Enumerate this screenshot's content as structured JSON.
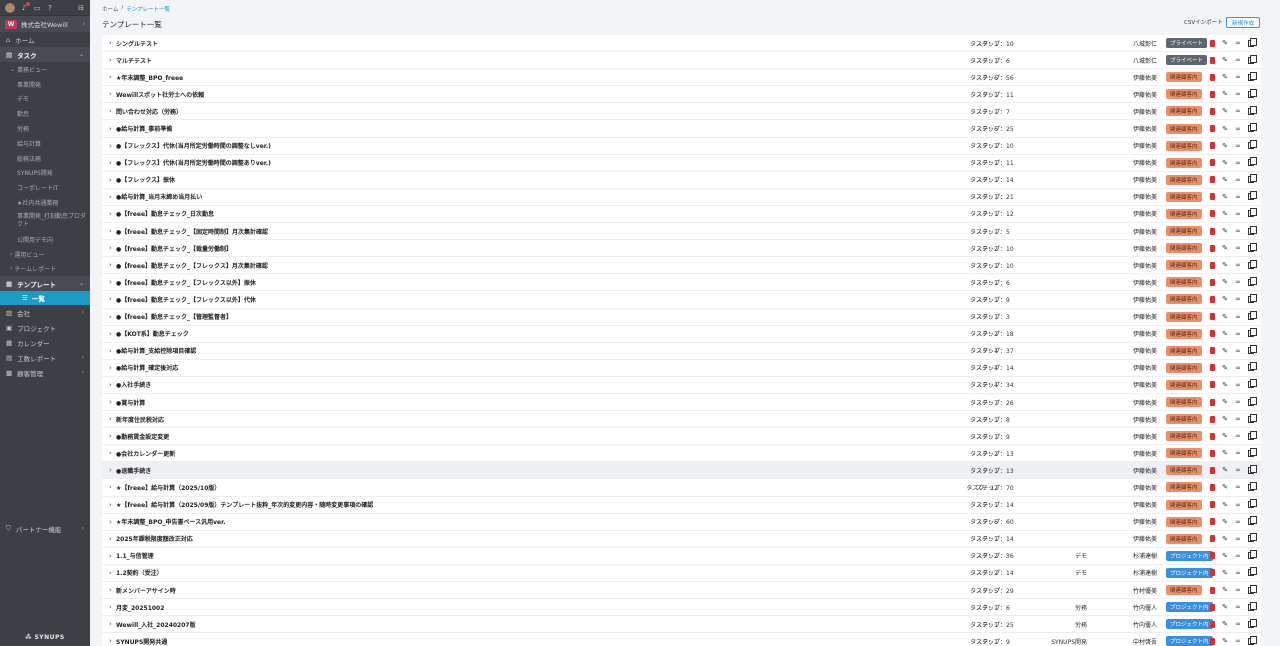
{
  "sidebar": {
    "company": "株式会社Wewill",
    "logo_text": "W",
    "home": "ホーム",
    "task": "タスク",
    "business_view": "業務ビュー",
    "business_view_items": [
      "事業開発",
      "デモ",
      "勤怠",
      "労務",
      "給与計算",
      "総務法務",
      "SYNUPS開発",
      "コーポレートIT",
      "★社内共通業務",
      "事業開発_打刻勤怠プロダクト",
      "公開用デモ向"
    ],
    "operation_view": "運用ビュー",
    "team_report": "チームレポート",
    "template": "テンプレート",
    "list_item": "一覧",
    "company_menu": "会社",
    "project": "プロジェクト",
    "calendar": "カレンダー",
    "work_report": "工数レポート",
    "client_mgmt": "顧客管理",
    "partner": "パートナー機能",
    "brand": "SYNUPS"
  },
  "breadcrumb": {
    "home": "ホーム",
    "sep": "/",
    "current": "テンプレート一覧"
  },
  "page": {
    "title": "テンプレート一覧",
    "csv_import": "CSVインポート",
    "new_button": "新規作成"
  },
  "colors": {
    "accent": "#1d9bc7",
    "private": "#5e6770",
    "related": "#e9906a",
    "project": "#3a8fe0",
    "delete": "#d9302d"
  },
  "rows": [
    {
      "name": "シングルテスト",
      "tasks": "タスク：1",
      "steps": "ステップ：10",
      "client": "",
      "person": "八城彰仁",
      "tag": "プライベート",
      "tag_type": "private"
    },
    {
      "name": "マルチテスト",
      "tasks": "タスク：1",
      "steps": "ステップ：6",
      "client": "",
      "person": "八城彰仁",
      "tag": "プライベート",
      "tag_type": "private"
    },
    {
      "name": "★年末調整_BPO_freee",
      "tasks": "タスク：6",
      "steps": "ステップ：56",
      "client": "",
      "person": "伊藤佑美",
      "tag": "関連顧客内",
      "tag_type": "related"
    },
    {
      "name": "Wewillスポット社労士への依頼",
      "tasks": "タスク：1",
      "steps": "ステップ：11",
      "client": "",
      "person": "伊藤佑美",
      "tag": "関連顧客内",
      "tag_type": "related"
    },
    {
      "name": "問い合わせ対応（労務）",
      "tasks": "タスク：1",
      "steps": "ステップ：7",
      "client": "",
      "person": "伊藤佑美",
      "tag": "関連顧客内",
      "tag_type": "related"
    },
    {
      "name": "●給与計算_事前準備",
      "tasks": "タスク：6",
      "steps": "ステップ：25",
      "client": "",
      "person": "伊藤佑美",
      "tag": "関連顧客内",
      "tag_type": "related"
    },
    {
      "name": "●【フレックス】代休(当月所定労働時間の調整なしver.)",
      "tasks": "タスク：1",
      "steps": "ステップ：10",
      "client": "",
      "person": "伊藤佑美",
      "tag": "関連顧客内",
      "tag_type": "related"
    },
    {
      "name": "●【フレックス】代休(当月所定労働時間の調整ありver.)",
      "tasks": "タスク：1",
      "steps": "ステップ：11",
      "client": "",
      "person": "伊藤佑美",
      "tag": "関連顧客内",
      "tag_type": "related"
    },
    {
      "name": "●【フレックス】振休",
      "tasks": "タスク：1",
      "steps": "ステップ：14",
      "client": "",
      "person": "伊藤佑美",
      "tag": "関連顧客内",
      "tag_type": "related"
    },
    {
      "name": "●給与計算_当月末締め当月払い",
      "tasks": "タスク：1",
      "steps": "ステップ：21",
      "client": "",
      "person": "伊藤佑美",
      "tag": "関連顧客内",
      "tag_type": "related"
    },
    {
      "name": "●【freee】勤怠チェック_日次勤怠",
      "tasks": "タスク：1",
      "steps": "ステップ：12",
      "client": "",
      "person": "伊藤佑美",
      "tag": "関連顧客内",
      "tag_type": "related"
    },
    {
      "name": "●【freee】勤怠チェック_【固定時間制】月次集計確認",
      "tasks": "タスク：1",
      "steps": "ステップ：5",
      "client": "",
      "person": "伊藤佑美",
      "tag": "関連顧客内",
      "tag_type": "related"
    },
    {
      "name": "●【freee】勤怠チェック_【裁量労働制】",
      "tasks": "タスク：2",
      "steps": "ステップ：10",
      "client": "",
      "person": "伊藤佑美",
      "tag": "関連顧客内",
      "tag_type": "related"
    },
    {
      "name": "●【freee】勤怠チェック_【フレックス】月次集計確認",
      "tasks": "タスク：1",
      "steps": "ステップ：10",
      "client": "",
      "person": "伊藤佑美",
      "tag": "関連顧客内",
      "tag_type": "related"
    },
    {
      "name": "●【freee】勤怠チェック_【フレックス以外】振休",
      "tasks": "タスク：1",
      "steps": "ステップ：6",
      "client": "",
      "person": "伊藤佑美",
      "tag": "関連顧客内",
      "tag_type": "related"
    },
    {
      "name": "●【freee】勤怠チェック_【フレックス以外】代休",
      "tasks": "タスク：1",
      "steps": "ステップ：9",
      "client": "",
      "person": "伊藤佑美",
      "tag": "関連顧客内",
      "tag_type": "related"
    },
    {
      "name": "●【freee】勤怠チェック_【管理監督者】",
      "tasks": "タスク：1",
      "steps": "ステップ：3",
      "client": "",
      "person": "伊藤佑美",
      "tag": "関連顧客内",
      "tag_type": "related"
    },
    {
      "name": "●【KOT系】勤怠チェック",
      "tasks": "タスク：2",
      "steps": "ステップ：18",
      "client": "",
      "person": "伊藤佑美",
      "tag": "関連顧客内",
      "tag_type": "related"
    },
    {
      "name": "●給与計算_支給控除項目確認",
      "tasks": "タスク：4",
      "steps": "ステップ：37",
      "client": "",
      "person": "伊藤佑美",
      "tag": "関連顧客内",
      "tag_type": "related"
    },
    {
      "name": "●給与計算_確定後対応",
      "tasks": "タスク：4",
      "steps": "ステップ：14",
      "client": "",
      "person": "伊藤佑美",
      "tag": "関連顧客内",
      "tag_type": "related"
    },
    {
      "name": "●入社手続き",
      "tasks": "タスク：4",
      "steps": "ステップ：34",
      "client": "",
      "person": "伊藤佑美",
      "tag": "関連顧客内",
      "tag_type": "related"
    },
    {
      "name": "●賞与計算",
      "tasks": "タスク：7",
      "steps": "ステップ：26",
      "client": "",
      "person": "伊藤佑美",
      "tag": "関連顧客内",
      "tag_type": "related"
    },
    {
      "name": "新年度住民税対応",
      "tasks": "タスク：1",
      "steps": "ステップ：8",
      "client": "",
      "person": "伊藤佑美",
      "tag": "関連顧客内",
      "tag_type": "related"
    },
    {
      "name": "●勤務賃金設定変更",
      "tasks": "タスク：1",
      "steps": "ステップ：9",
      "client": "",
      "person": "伊藤佑美",
      "tag": "関連顧客内",
      "tag_type": "related"
    },
    {
      "name": "●会社カレンダー更新",
      "tasks": "タスク：2",
      "steps": "ステップ：13",
      "client": "",
      "person": "伊藤佑美",
      "tag": "関連顧客内",
      "tag_type": "related"
    },
    {
      "name": "●退職手続き",
      "tasks": "タスク：1",
      "steps": "ステップ：13",
      "client": "",
      "person": "伊藤佑美",
      "tag": "関連顧客内",
      "tag_type": "related",
      "highlight": true
    },
    {
      "name": "★【freee】給与計算（2025/10版）",
      "tasks": "タスク：12",
      "steps": "ステップ：70",
      "client": "",
      "person": "伊藤佑美",
      "tag": "関連顧客内",
      "tag_type": "related"
    },
    {
      "name": "★【freee】給与計算（2025/09版）テンプレート抜粋_年次的変更内容・随時変更事項の確認",
      "tasks": "タスク：1",
      "steps": "ステップ：14",
      "client": "",
      "person": "伊藤佑美",
      "tag": "関連顧客内",
      "tag_type": "related"
    },
    {
      "name": "★年末調整_BPO_申告書ベース汎用ver.",
      "tasks": "タスク：6",
      "steps": "ステップ：60",
      "client": "",
      "person": "伊藤佑美",
      "tag": "関連顧客内",
      "tag_type": "related"
    },
    {
      "name": "2025年課税限度額改正対応",
      "tasks": "タスク：1",
      "steps": "ステップ：14",
      "client": "",
      "person": "伊藤佑美",
      "tag": "関連顧客内",
      "tag_type": "related"
    },
    {
      "name": "1.1_与信管理",
      "tasks": "タスク：2",
      "steps": "ステップ：36",
      "client": "デモ",
      "person": "杉浦達樹",
      "tag": "プロジェクト内",
      "tag_type": "project"
    },
    {
      "name": "1.2契約（受注）",
      "tasks": "タスク：2",
      "steps": "ステップ：14",
      "client": "デモ",
      "person": "杉浦達樹",
      "tag": "プロジェクト内",
      "tag_type": "project"
    },
    {
      "name": "新メンバーアサイン時",
      "tasks": "タスク：5",
      "steps": "ステップ：29",
      "client": "",
      "person": "竹村優美",
      "tag": "関連顧客内",
      "tag_type": "related"
    },
    {
      "name": "月変_20251002",
      "tasks": "タスク：1",
      "steps": "ステップ：6",
      "client": "労務",
      "person": "竹内優人",
      "tag": "プロジェクト内",
      "tag_type": "project"
    },
    {
      "name": "Wewill_入社_20240207版",
      "tasks": "タスク：1",
      "steps": "ステップ：25",
      "client": "労務",
      "person": "竹内優人",
      "tag": "プロジェクト内",
      "tag_type": "project"
    },
    {
      "name": "SYNUPS開発共通",
      "tasks": "タスク：1",
      "steps": "ステップ：9",
      "client": "SYNUPS開発",
      "person": "中村啓吾",
      "tag": "プロジェクト内",
      "tag_type": "project"
    }
  ]
}
